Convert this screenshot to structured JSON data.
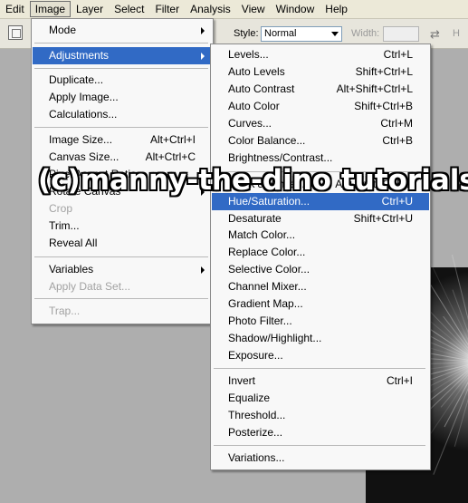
{
  "menubar": {
    "items": [
      "Edit",
      "Image",
      "Layer",
      "Select",
      "Filter",
      "Analysis",
      "View",
      "Window",
      "Help"
    ],
    "active": "Image"
  },
  "options": {
    "style_label": "Style:",
    "style_value": "Normal",
    "width_label": "Width:",
    "height_label": "H"
  },
  "image_menu": {
    "items": [
      {
        "label": "Mode",
        "shortcut": "",
        "submenu": true
      },
      {
        "label": "Adjustments",
        "shortcut": "",
        "submenu": true,
        "highlighted": true
      },
      {
        "label": "Duplicate...",
        "shortcut": ""
      },
      {
        "label": "Apply Image...",
        "shortcut": ""
      },
      {
        "label": "Calculations...",
        "shortcut": ""
      },
      {
        "label": "Image Size...",
        "shortcut": "Alt+Ctrl+I"
      },
      {
        "label": "Canvas Size...",
        "shortcut": "Alt+Ctrl+C"
      },
      {
        "label": "Pixel Aspect Ratio",
        "shortcut": "",
        "submenu": true
      },
      {
        "label": "Rotate Canvas",
        "shortcut": "",
        "submenu": true
      },
      {
        "label": "Crop",
        "shortcut": "",
        "disabled": true
      },
      {
        "label": "Trim...",
        "shortcut": ""
      },
      {
        "label": "Reveal All",
        "shortcut": ""
      },
      {
        "label": "Variables",
        "shortcut": "",
        "submenu": true
      },
      {
        "label": "Apply Data Set...",
        "shortcut": "",
        "disabled": true
      },
      {
        "label": "Trap...",
        "shortcut": "",
        "disabled": true
      }
    ]
  },
  "adjustments_menu": {
    "items": [
      {
        "label": "Levels...",
        "shortcut": "Ctrl+L"
      },
      {
        "label": "Auto Levels",
        "shortcut": "Shift+Ctrl+L"
      },
      {
        "label": "Auto Contrast",
        "shortcut": "Alt+Shift+Ctrl+L"
      },
      {
        "label": "Auto Color",
        "shortcut": "Shift+Ctrl+B"
      },
      {
        "label": "Curves...",
        "shortcut": "Ctrl+M"
      },
      {
        "label": "Color Balance...",
        "shortcut": "Ctrl+B"
      },
      {
        "label": "Brightness/Contrast...",
        "shortcut": ""
      },
      {
        "label": "Black & White...",
        "shortcut": "Alt+Shift+Ctrl+B"
      },
      {
        "label": "Hue/Saturation...",
        "shortcut": "Ctrl+U",
        "highlighted": true
      },
      {
        "label": "Desaturate",
        "shortcut": "Shift+Ctrl+U"
      },
      {
        "label": "Match Color...",
        "shortcut": ""
      },
      {
        "label": "Replace Color...",
        "shortcut": ""
      },
      {
        "label": "Selective Color...",
        "shortcut": ""
      },
      {
        "label": "Channel Mixer...",
        "shortcut": ""
      },
      {
        "label": "Gradient Map...",
        "shortcut": ""
      },
      {
        "label": "Photo Filter...",
        "shortcut": ""
      },
      {
        "label": "Shadow/Highlight...",
        "shortcut": ""
      },
      {
        "label": "Exposure...",
        "shortcut": ""
      },
      {
        "label": "Invert",
        "shortcut": "Ctrl+I"
      },
      {
        "label": "Equalize",
        "shortcut": ""
      },
      {
        "label": "Threshold...",
        "shortcut": ""
      },
      {
        "label": "Posterize...",
        "shortcut": ""
      },
      {
        "label": "Variations...",
        "shortcut": ""
      }
    ]
  },
  "watermark": "(c)manny-the-dino tutorials",
  "colors": {
    "highlight": "#316ac5",
    "menubar": "#ece9d8",
    "background": "#aeaeae"
  }
}
